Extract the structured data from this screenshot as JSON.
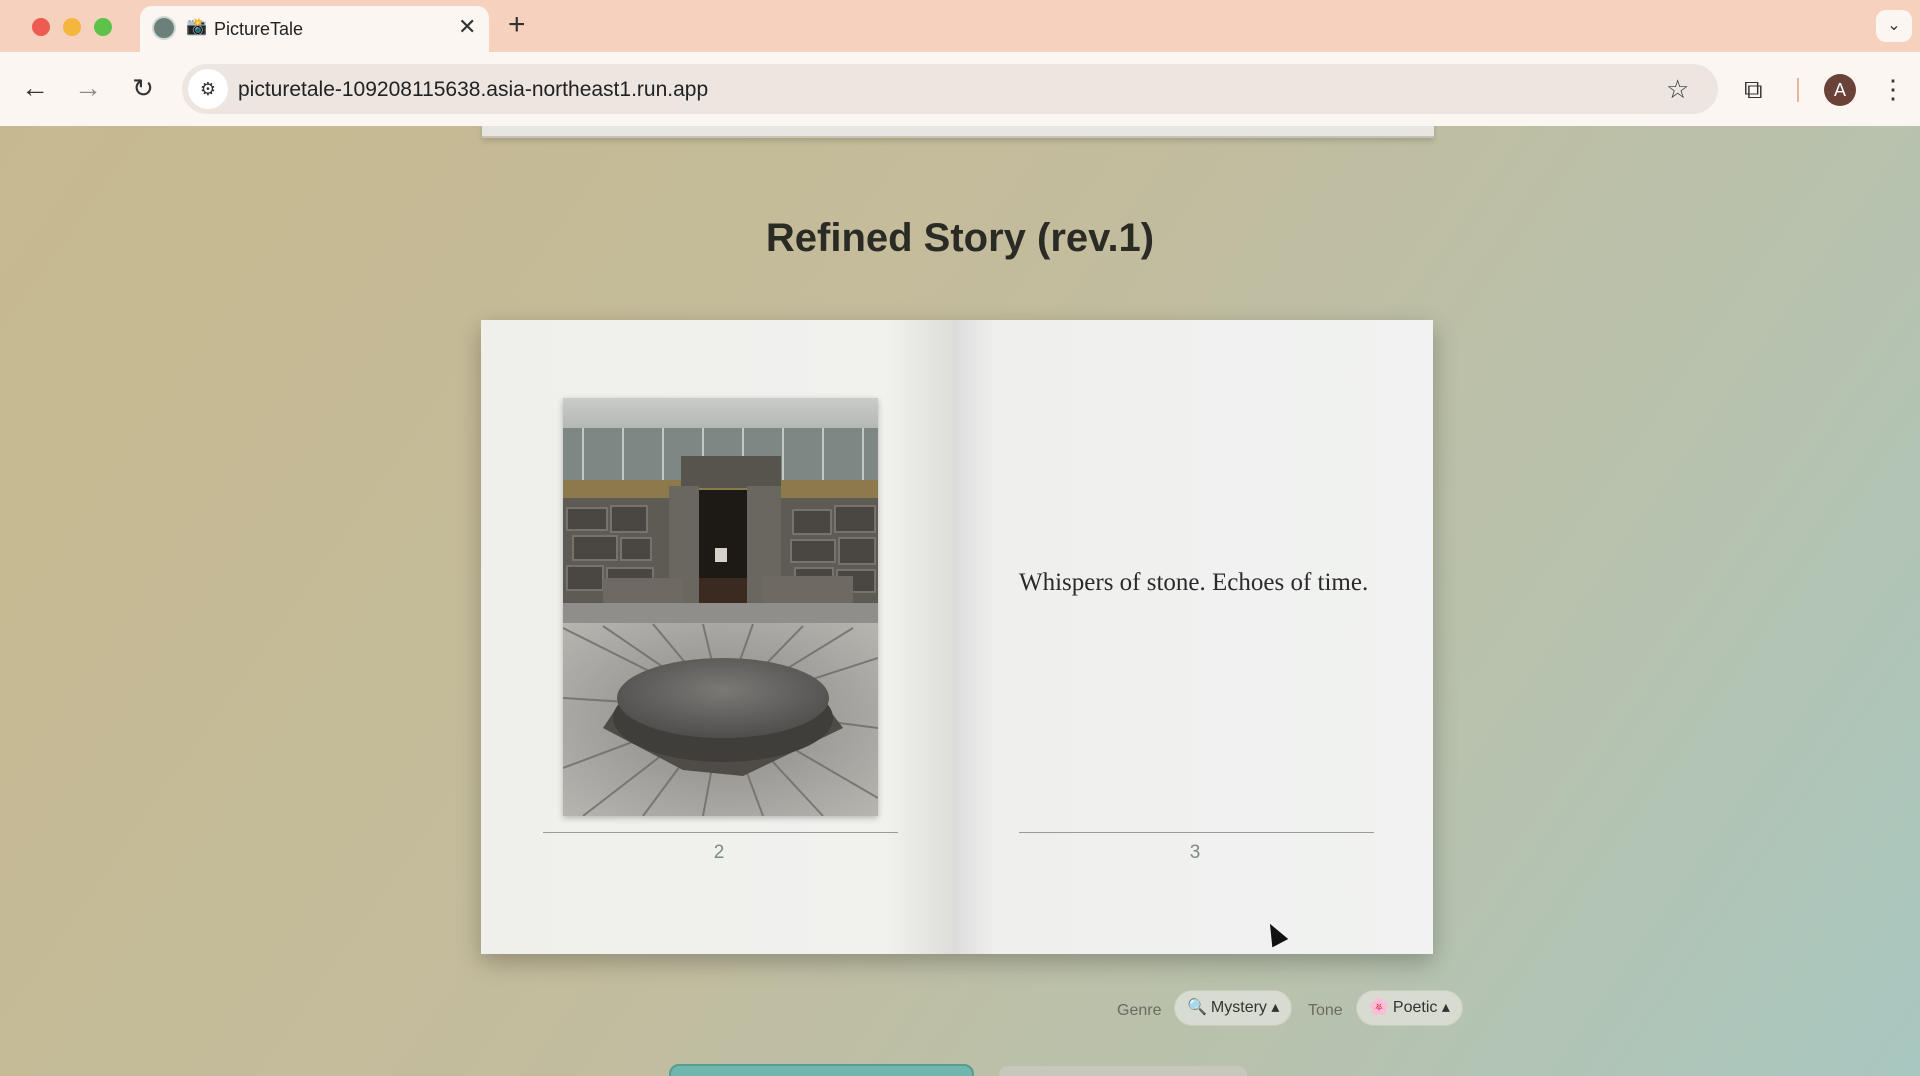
{
  "browser": {
    "tab": {
      "emoji": "📸",
      "title": "PictureTale"
    },
    "url": "picturetale-109208115638.asia-northeast1.run.app",
    "profile_initial": "A"
  },
  "page": {
    "story_title": "Refined Story (rev.1)",
    "left_page": {
      "number": "2",
      "image_alt": "Stone doorway and round stone slab in a paved plaza"
    },
    "right_page": {
      "text": "Whispers of stone. Echoes of time.",
      "number": "3"
    },
    "genre": {
      "label": "Genre",
      "icon": "🔍",
      "value": "Mystery ▴"
    },
    "tone": {
      "label": "Tone",
      "icon": "🌸",
      "value": "Poetic ▴"
    }
  }
}
